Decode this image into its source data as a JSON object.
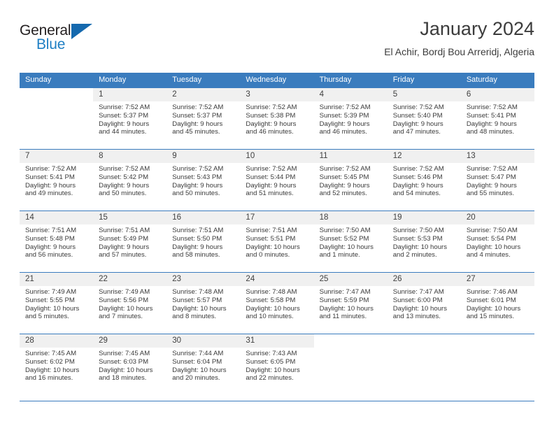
{
  "brand": {
    "word_general": "General",
    "word_blue": "Blue",
    "triangle_color": "#1569ae",
    "blue_color": "#1f7fc4"
  },
  "header": {
    "title": "January 2024",
    "subtitle": "El Achir, Bordj Bou Arreridj, Algeria"
  },
  "theme": {
    "header_bg": "#3a7cbe",
    "daynum_bg": "#f0f0f0",
    "text_color": "#3a3a3a"
  },
  "calendar": {
    "weekday_headers": [
      "Sunday",
      "Monday",
      "Tuesday",
      "Wednesday",
      "Thursday",
      "Friday",
      "Saturday"
    ],
    "weeks": [
      [
        {
          "day": "",
          "blank": true,
          "sunrise": "",
          "sunset": "",
          "daylight1": "",
          "daylight2": ""
        },
        {
          "day": "1",
          "sunrise": "Sunrise: 7:52 AM",
          "sunset": "Sunset: 5:37 PM",
          "daylight1": "Daylight: 9 hours",
          "daylight2": "and 44 minutes."
        },
        {
          "day": "2",
          "sunrise": "Sunrise: 7:52 AM",
          "sunset": "Sunset: 5:37 PM",
          "daylight1": "Daylight: 9 hours",
          "daylight2": "and 45 minutes."
        },
        {
          "day": "3",
          "sunrise": "Sunrise: 7:52 AM",
          "sunset": "Sunset: 5:38 PM",
          "daylight1": "Daylight: 9 hours",
          "daylight2": "and 46 minutes."
        },
        {
          "day": "4",
          "sunrise": "Sunrise: 7:52 AM",
          "sunset": "Sunset: 5:39 PM",
          "daylight1": "Daylight: 9 hours",
          "daylight2": "and 46 minutes."
        },
        {
          "day": "5",
          "sunrise": "Sunrise: 7:52 AM",
          "sunset": "Sunset: 5:40 PM",
          "daylight1": "Daylight: 9 hours",
          "daylight2": "and 47 minutes."
        },
        {
          "day": "6",
          "sunrise": "Sunrise: 7:52 AM",
          "sunset": "Sunset: 5:41 PM",
          "daylight1": "Daylight: 9 hours",
          "daylight2": "and 48 minutes."
        }
      ],
      [
        {
          "day": "7",
          "sunrise": "Sunrise: 7:52 AM",
          "sunset": "Sunset: 5:41 PM",
          "daylight1": "Daylight: 9 hours",
          "daylight2": "and 49 minutes."
        },
        {
          "day": "8",
          "sunrise": "Sunrise: 7:52 AM",
          "sunset": "Sunset: 5:42 PM",
          "daylight1": "Daylight: 9 hours",
          "daylight2": "and 50 minutes."
        },
        {
          "day": "9",
          "sunrise": "Sunrise: 7:52 AM",
          "sunset": "Sunset: 5:43 PM",
          "daylight1": "Daylight: 9 hours",
          "daylight2": "and 50 minutes."
        },
        {
          "day": "10",
          "sunrise": "Sunrise: 7:52 AM",
          "sunset": "Sunset: 5:44 PM",
          "daylight1": "Daylight: 9 hours",
          "daylight2": "and 51 minutes."
        },
        {
          "day": "11",
          "sunrise": "Sunrise: 7:52 AM",
          "sunset": "Sunset: 5:45 PM",
          "daylight1": "Daylight: 9 hours",
          "daylight2": "and 52 minutes."
        },
        {
          "day": "12",
          "sunrise": "Sunrise: 7:52 AM",
          "sunset": "Sunset: 5:46 PM",
          "daylight1": "Daylight: 9 hours",
          "daylight2": "and 54 minutes."
        },
        {
          "day": "13",
          "sunrise": "Sunrise: 7:52 AM",
          "sunset": "Sunset: 5:47 PM",
          "daylight1": "Daylight: 9 hours",
          "daylight2": "and 55 minutes."
        }
      ],
      [
        {
          "day": "14",
          "sunrise": "Sunrise: 7:51 AM",
          "sunset": "Sunset: 5:48 PM",
          "daylight1": "Daylight: 9 hours",
          "daylight2": "and 56 minutes."
        },
        {
          "day": "15",
          "sunrise": "Sunrise: 7:51 AM",
          "sunset": "Sunset: 5:49 PM",
          "daylight1": "Daylight: 9 hours",
          "daylight2": "and 57 minutes."
        },
        {
          "day": "16",
          "sunrise": "Sunrise: 7:51 AM",
          "sunset": "Sunset: 5:50 PM",
          "daylight1": "Daylight: 9 hours",
          "daylight2": "and 58 minutes."
        },
        {
          "day": "17",
          "sunrise": "Sunrise: 7:51 AM",
          "sunset": "Sunset: 5:51 PM",
          "daylight1": "Daylight: 10 hours",
          "daylight2": "and 0 minutes."
        },
        {
          "day": "18",
          "sunrise": "Sunrise: 7:50 AM",
          "sunset": "Sunset: 5:52 PM",
          "daylight1": "Daylight: 10 hours",
          "daylight2": "and 1 minute."
        },
        {
          "day": "19",
          "sunrise": "Sunrise: 7:50 AM",
          "sunset": "Sunset: 5:53 PM",
          "daylight1": "Daylight: 10 hours",
          "daylight2": "and 2 minutes."
        },
        {
          "day": "20",
          "sunrise": "Sunrise: 7:50 AM",
          "sunset": "Sunset: 5:54 PM",
          "daylight1": "Daylight: 10 hours",
          "daylight2": "and 4 minutes."
        }
      ],
      [
        {
          "day": "21",
          "sunrise": "Sunrise: 7:49 AM",
          "sunset": "Sunset: 5:55 PM",
          "daylight1": "Daylight: 10 hours",
          "daylight2": "and 5 minutes."
        },
        {
          "day": "22",
          "sunrise": "Sunrise: 7:49 AM",
          "sunset": "Sunset: 5:56 PM",
          "daylight1": "Daylight: 10 hours",
          "daylight2": "and 7 minutes."
        },
        {
          "day": "23",
          "sunrise": "Sunrise: 7:48 AM",
          "sunset": "Sunset: 5:57 PM",
          "daylight1": "Daylight: 10 hours",
          "daylight2": "and 8 minutes."
        },
        {
          "day": "24",
          "sunrise": "Sunrise: 7:48 AM",
          "sunset": "Sunset: 5:58 PM",
          "daylight1": "Daylight: 10 hours",
          "daylight2": "and 10 minutes."
        },
        {
          "day": "25",
          "sunrise": "Sunrise: 7:47 AM",
          "sunset": "Sunset: 5:59 PM",
          "daylight1": "Daylight: 10 hours",
          "daylight2": "and 11 minutes."
        },
        {
          "day": "26",
          "sunrise": "Sunrise: 7:47 AM",
          "sunset": "Sunset: 6:00 PM",
          "daylight1": "Daylight: 10 hours",
          "daylight2": "and 13 minutes."
        },
        {
          "day": "27",
          "sunrise": "Sunrise: 7:46 AM",
          "sunset": "Sunset: 6:01 PM",
          "daylight1": "Daylight: 10 hours",
          "daylight2": "and 15 minutes."
        }
      ],
      [
        {
          "day": "28",
          "sunrise": "Sunrise: 7:45 AM",
          "sunset": "Sunset: 6:02 PM",
          "daylight1": "Daylight: 10 hours",
          "daylight2": "and 16 minutes."
        },
        {
          "day": "29",
          "sunrise": "Sunrise: 7:45 AM",
          "sunset": "Sunset: 6:03 PM",
          "daylight1": "Daylight: 10 hours",
          "daylight2": "and 18 minutes."
        },
        {
          "day": "30",
          "sunrise": "Sunrise: 7:44 AM",
          "sunset": "Sunset: 6:04 PM",
          "daylight1": "Daylight: 10 hours",
          "daylight2": "and 20 minutes."
        },
        {
          "day": "31",
          "sunrise": "Sunrise: 7:43 AM",
          "sunset": "Sunset: 6:05 PM",
          "daylight1": "Daylight: 10 hours",
          "daylight2": "and 22 minutes."
        },
        {
          "day": "",
          "blank": true,
          "sunrise": "",
          "sunset": "",
          "daylight1": "",
          "daylight2": ""
        },
        {
          "day": "",
          "blank": true,
          "sunrise": "",
          "sunset": "",
          "daylight1": "",
          "daylight2": ""
        },
        {
          "day": "",
          "blank": true,
          "sunrise": "",
          "sunset": "",
          "daylight1": "",
          "daylight2": ""
        }
      ]
    ]
  }
}
